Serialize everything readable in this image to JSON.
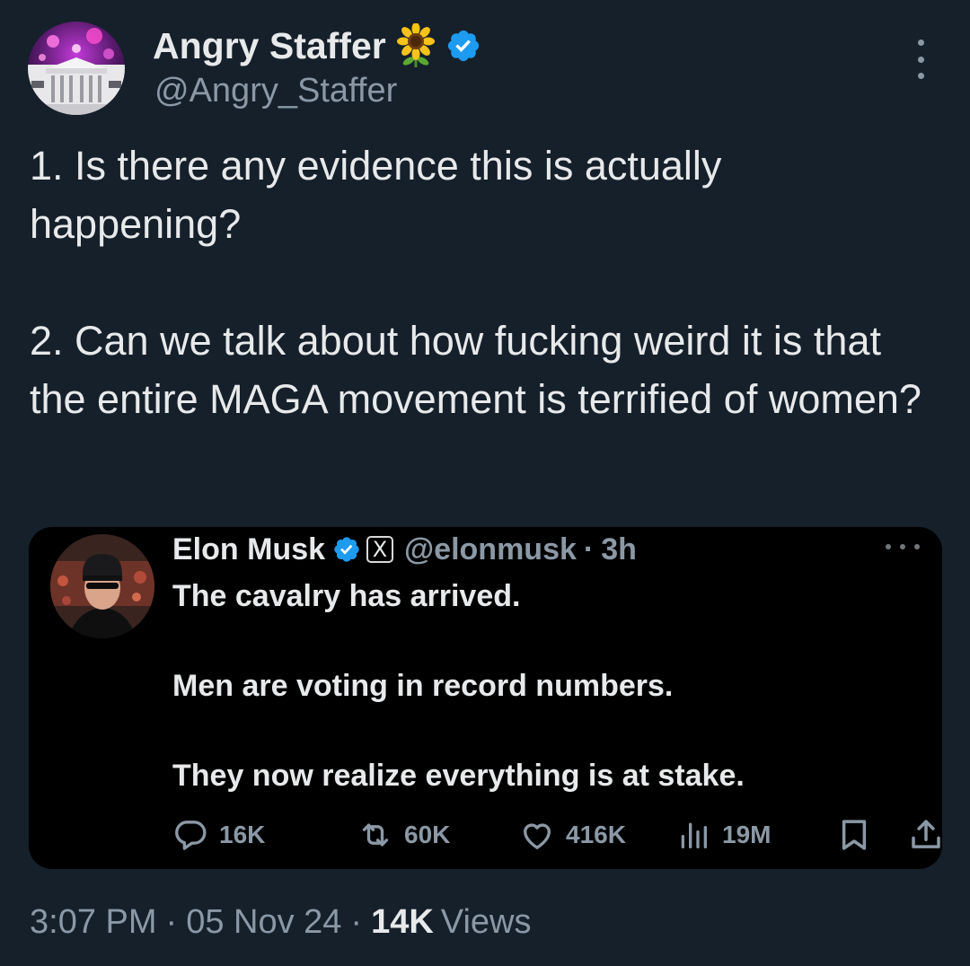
{
  "tweet": {
    "author_name": "Angry Staffer",
    "author_emoji_icon": "sunflower-icon",
    "verified_icon": "verified-badge-icon",
    "handle": "@Angry_Staffer",
    "text_lines": [
      "1. Is there any evidence this is actually happening?",
      "2. Can we talk about how fucking weird it is that the entire MAGA movement is terrified of women?"
    ],
    "time": "3:07 PM",
    "separator": "·",
    "date": "05 Nov 24",
    "views_count": "14K",
    "views_label": "Views"
  },
  "quote": {
    "author_name": "Elon Musk",
    "verified_icon": "verified-badge-icon",
    "affiliate_badge": "X",
    "handle": "@elonmusk",
    "separator": "·",
    "time": "3h",
    "lines": [
      "The cavalry has arrived.",
      "Men are voting in record numbers.",
      "They now realize everything is at stake."
    ],
    "actions": {
      "replies": "16K",
      "reposts": "60K",
      "likes": "416K",
      "views": "19M"
    }
  },
  "colors": {
    "background": "#15202b",
    "card_background": "#000000",
    "text_primary": "#e7e9ea",
    "text_secondary": "#8b98a5",
    "verified_blue": "#1d9bf0"
  }
}
